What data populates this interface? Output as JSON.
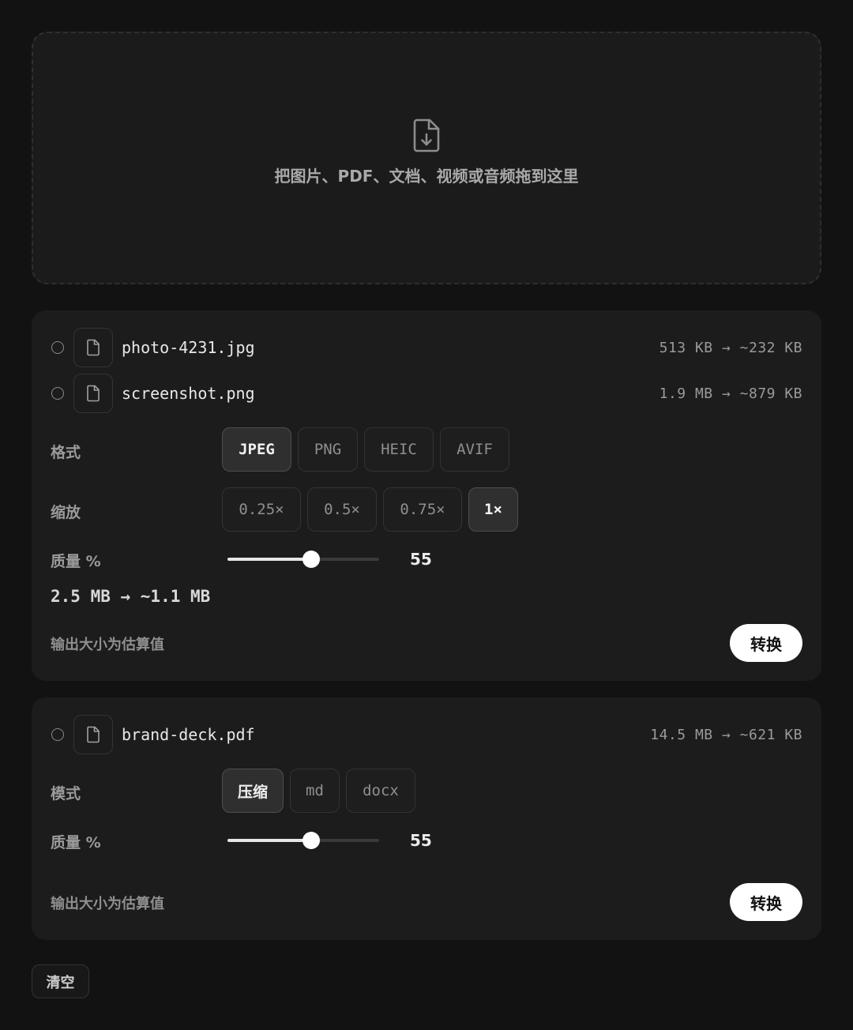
{
  "dropzone": {
    "icon": "file-download-icon",
    "text": "把图片、PDF、文档、视频或音频拖到这里"
  },
  "image_group": {
    "files": [
      {
        "name": "photo-4231.jpg",
        "size": "513 KB → ~232 KB",
        "icon": "file-icon"
      },
      {
        "name": "screenshot.png",
        "size": "1.9 MB → ~879 KB",
        "icon": "file-icon"
      }
    ],
    "format_label": "格式",
    "formats": [
      {
        "label": "JPEG",
        "active": true
      },
      {
        "label": "PNG",
        "active": false
      },
      {
        "label": "HEIC",
        "active": false
      },
      {
        "label": "AVIF",
        "active": false
      }
    ],
    "scale_label": "缩放",
    "scales": [
      {
        "label": "0.25×",
        "active": false
      },
      {
        "label": "0.5×",
        "active": false
      },
      {
        "label": "0.75×",
        "active": false
      },
      {
        "label": "1×",
        "active": true
      }
    ],
    "quality_label": "质量 %",
    "quality_value": "55",
    "quality_fraction": 0.55,
    "total": "2.5 MB → ~1.1 MB",
    "note": "输出大小为估算值",
    "convert_label": "转换"
  },
  "pdf_group": {
    "files": [
      {
        "name": "brand-deck.pdf",
        "size": "14.5 MB → ~621 KB",
        "icon": "file-icon"
      }
    ],
    "mode_label": "模式",
    "modes": [
      {
        "label": "压缩",
        "active": true
      },
      {
        "label": "md",
        "active": false
      },
      {
        "label": "docx",
        "active": false
      }
    ],
    "quality_label": "质量 %",
    "quality_value": "55",
    "quality_fraction": 0.55,
    "note": "输出大小为估算值",
    "convert_label": "转换"
  },
  "clear_label": "清空",
  "colors": {
    "background": "#121212",
    "card": "#1c1c1c",
    "accent": "#ffffff"
  }
}
